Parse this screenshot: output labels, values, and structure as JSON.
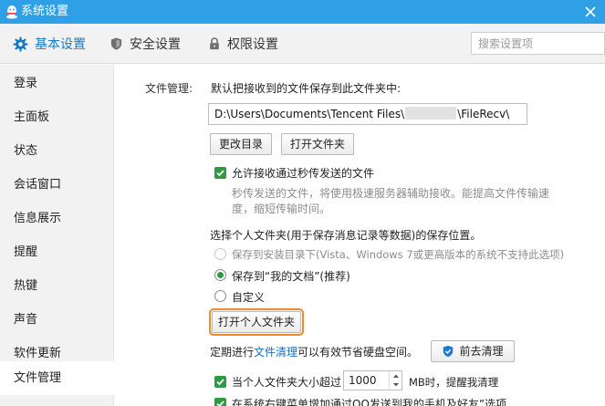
{
  "window": {
    "title": "系统设置"
  },
  "tabs": [
    {
      "label": "基本设置",
      "icon": "gear-icon",
      "active": true
    },
    {
      "label": "安全设置",
      "icon": "shield-icon",
      "active": false
    },
    {
      "label": "权限设置",
      "icon": "lock-icon",
      "active": false
    }
  ],
  "search": {
    "placeholder": "搜索设置项",
    "value": ""
  },
  "sidebar": {
    "items": [
      {
        "label": "登录"
      },
      {
        "label": "主面板"
      },
      {
        "label": "状态"
      },
      {
        "label": "会话窗口"
      },
      {
        "label": "信息展示"
      },
      {
        "label": "提醒"
      },
      {
        "label": "热键"
      },
      {
        "label": "声音"
      },
      {
        "label": "软件更新"
      },
      {
        "label": "文件管理",
        "active": true
      }
    ]
  },
  "file_management": {
    "section_label": "文件管理:",
    "save_desc": "默认把接收到的文件保存到此文件夹中:",
    "path_prefix": "D:\\Users\\Documents\\Tencent Files\\",
    "path_suffix": "\\FileRecv\\",
    "change_dir_button": "更改目录",
    "open_folder_button": "打开文件夹",
    "allow_flash_label": "允许接收通过秒传发送的文件",
    "allow_flash_checked": true,
    "flash_desc_line1": "秒传发送的文件，将使用极速服务器辅助接收。能提高文件传输速",
    "flash_desc_line2": "度，缩短传输时间。",
    "personal_folder_desc": "选择个人文件夹(用于保存消息记录等数据)的保存位置。",
    "radio_options": [
      {
        "label": "保存到安装目录下(Vista、Windows 7或更高版本的系统不支持此选项)",
        "disabled": true,
        "selected": false
      },
      {
        "label": "保存到“我的文档”(推荐)",
        "disabled": false,
        "selected": true
      },
      {
        "label": "自定义",
        "disabled": false,
        "selected": false
      }
    ],
    "open_personal_button": "打开个人文件夹",
    "cleanup_prefix": "定期进行",
    "cleanup_link": "文件清理",
    "cleanup_suffix": "可以有效节省硬盘空间。",
    "cleanup_button": "前去清理",
    "size_alert_prefix": "当个人文件夹大小超过",
    "size_alert_value": "1000",
    "size_alert_suffix": "MB时，提醒我清理",
    "size_alert_checked": true,
    "context_menu_label": "在系统右键菜单增加通过QQ发送到我的手机及好友”选项",
    "context_menu_checked": true
  }
}
